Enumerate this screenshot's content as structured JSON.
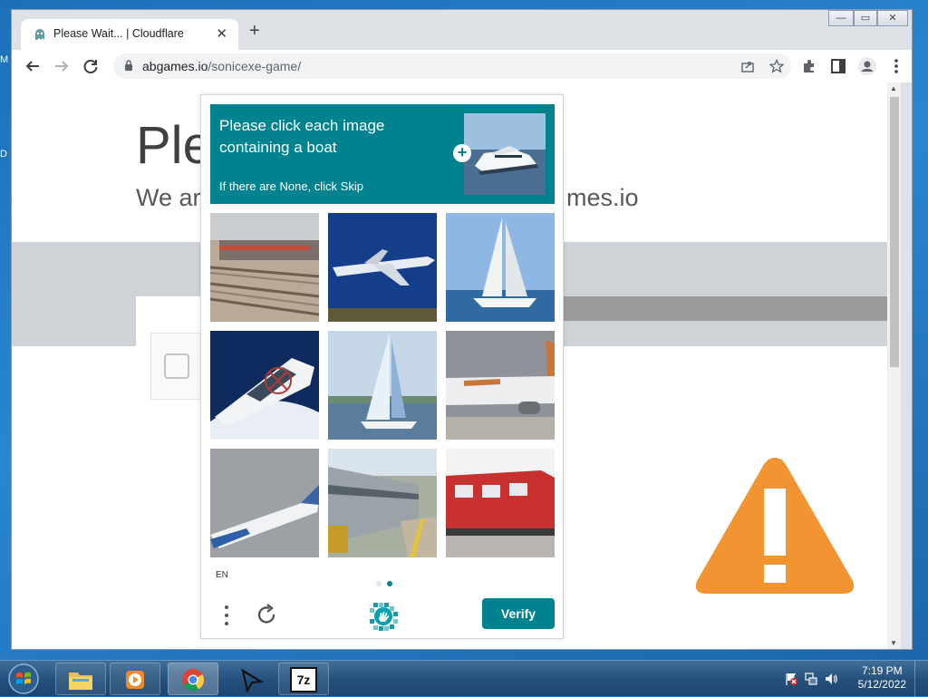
{
  "desktop": {
    "edge_labels": [
      "M",
      "D"
    ]
  },
  "browser": {
    "tab_title": "Please Wait... | Cloudflare",
    "tab_close": "✕",
    "new_tab": "+",
    "url_host": "abgames.io",
    "url_path": "/sonicexe-game/",
    "window_controls": {
      "minimize": "—",
      "maximize": "▭",
      "close": "✕"
    }
  },
  "page": {
    "title_fragment": "Ple",
    "subtitle_left": "We ar",
    "subtitle_right": "mes.io"
  },
  "captcha": {
    "question": "Please click each image containing a boat",
    "hint": "If there are None, click Skip",
    "language": "EN",
    "verify_label": "Verify",
    "accent_color": "#00838f",
    "page_dots": 2,
    "active_dot": 2,
    "tiles": [
      {
        "subject": "train station"
      },
      {
        "subject": "airplane"
      },
      {
        "subject": "sailboat"
      },
      {
        "subject": "motor yacht"
      },
      {
        "subject": "sailboat"
      },
      {
        "subject": "airplane"
      },
      {
        "subject": "airplane"
      },
      {
        "subject": "train"
      },
      {
        "subject": "red locomotive"
      }
    ]
  },
  "taskbar": {
    "time": "7:19 PM",
    "date": "5/12/2022",
    "apps": [
      "windows-explorer",
      "media-player",
      "chrome",
      "cursor-app",
      "7zip"
    ],
    "sevenzip_label": "7z"
  }
}
